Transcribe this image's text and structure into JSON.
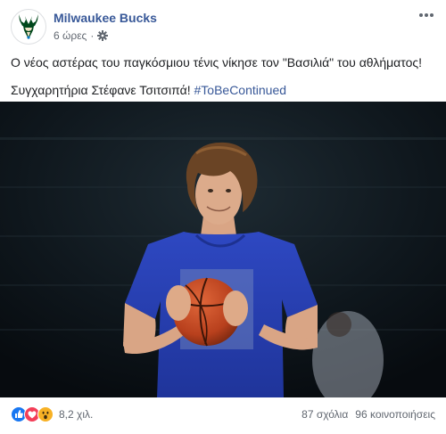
{
  "post": {
    "page_name": "Milwaukee Bucks",
    "time": "6 ώρες",
    "separator": "·",
    "audience_icon": "gear-icon",
    "more_icon": "more-options-icon",
    "text_line1": "Ο νέος αστέρας του παγκόσμιου τένις νίκησε τον \"Βασιλιά\" του αθλήματος!",
    "text_line2": "Συγχαρητήρια Στέφανε Τσιτσιπά! ",
    "hashtag": "#ToBeContinued",
    "photo_icon": "post-photo"
  },
  "footer": {
    "reactions": [
      "like-reaction-icon",
      "love-reaction-icon",
      "wow-reaction-icon"
    ],
    "reaction_count": "8,2 χιλ.",
    "comments": "87 σχόλια",
    "shares": "96 κοινοποιήσεις"
  },
  "colors": {
    "link": "#385898",
    "secondary_text": "#616770",
    "like": "#1877f2",
    "love": "#f33e58",
    "wow": "#f7b125",
    "shirt": "#2b44b8",
    "ball": "#c94a25"
  }
}
